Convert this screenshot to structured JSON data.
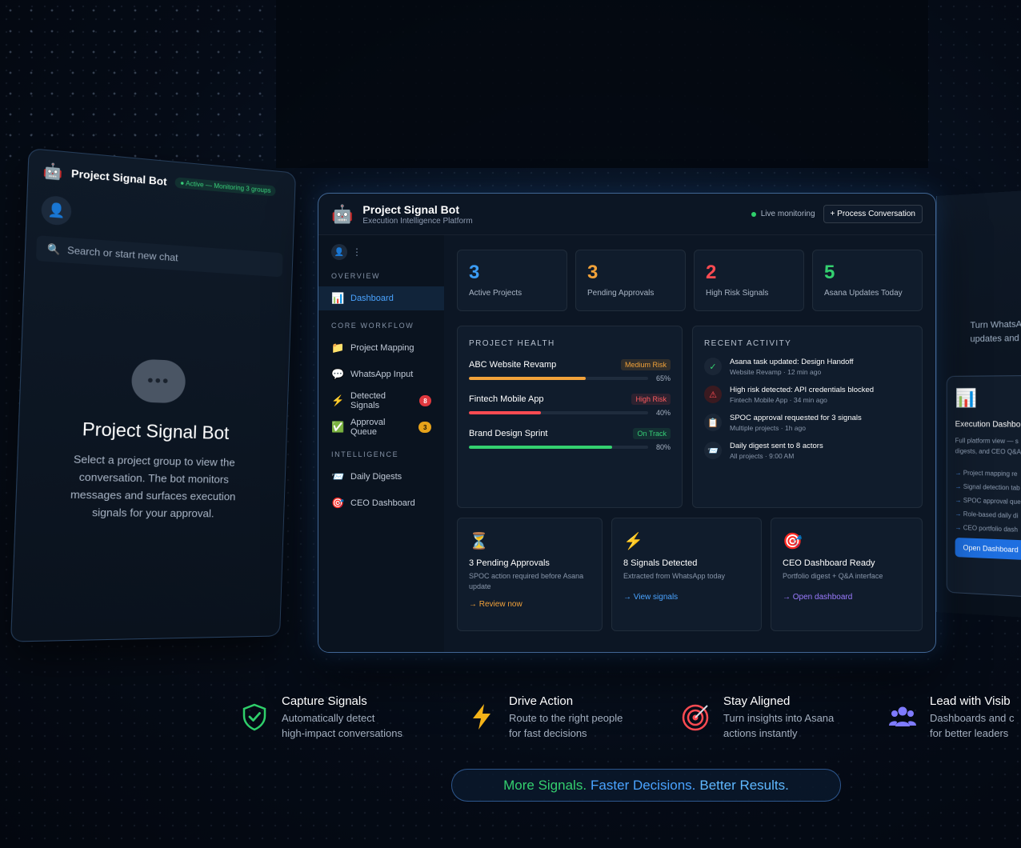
{
  "left_panel": {
    "title": "Project Signal Bot",
    "status": "● Active — Monitoring 3 groups",
    "search_placeholder": "Search or start new chat",
    "heading": "Project Signal Bot",
    "description": "Select a project group to view the conversation. The bot monitors messages and surfaces execution signals for your approval."
  },
  "right_panel": {
    "intro_line1": "Turn WhatsA",
    "intro_line2": "updates and",
    "card_title": "Execution Dashbo",
    "card_desc_line1": "Full platform view — s",
    "card_desc_line2": "digests, and CEO Q&A i",
    "items": [
      "Project mapping re",
      "Signal detection tab",
      "SPOC approval que",
      "Role-based daily di",
      "CEO portfolio dash"
    ],
    "button": "Open Dashboard"
  },
  "header": {
    "title": "Project Signal Bot",
    "subtitle": "Execution Intelligence Platform",
    "live": "Live monitoring",
    "process_button": "+ Process Conversation"
  },
  "sidebar": {
    "sections": {
      "overview": "OVERVIEW",
      "core": "CORE WORKFLOW",
      "intel": "INTELLIGENCE"
    },
    "items": [
      {
        "label": "Dashboard"
      },
      {
        "label": "Project Mapping"
      },
      {
        "label": "WhatsApp Input"
      },
      {
        "label": "Detected Signals",
        "badge": "8"
      },
      {
        "label": "Approval Queue",
        "badge": "3"
      },
      {
        "label": "Daily Digests"
      },
      {
        "label": "CEO Dashboard"
      }
    ]
  },
  "stats": [
    {
      "value": "3",
      "label": "Active Projects",
      "color": "#3b9cf5"
    },
    {
      "value": "3",
      "label": "Pending Approvals",
      "color": "#f2a23a"
    },
    {
      "value": "2",
      "label": "High Risk Signals",
      "color": "#ff4b52"
    },
    {
      "value": "5",
      "label": "Asana Updates Today",
      "color": "#34d06f"
    }
  ],
  "health": {
    "title": "PROJECT HEALTH",
    "projects": [
      {
        "name": "ABC Website Revamp",
        "status": "Medium Risk",
        "percent": "65%",
        "value": 0.65,
        "color": "#f2a23a"
      },
      {
        "name": "Fintech Mobile App",
        "status": "High Risk",
        "percent": "40%",
        "value": 0.4,
        "color": "#ff4b52"
      },
      {
        "name": "Brand Design Sprint",
        "status": "On Track",
        "percent": "80%",
        "value": 0.8,
        "color": "#34d06f"
      }
    ]
  },
  "activity": {
    "title": "RECENT ACTIVITY",
    "items": [
      {
        "icon": "✓",
        "text": "Asana task updated: Design Handoff",
        "meta": "Website Revamp · 12 min ago"
      },
      {
        "icon": "⚠",
        "text": "High risk detected: API credentials blocked",
        "meta": "Fintech Mobile App · 34 min ago"
      },
      {
        "icon": "📋",
        "text": "SPOC approval requested for 3 signals",
        "meta": "Multiple projects · 1h ago"
      },
      {
        "icon": "📨",
        "text": "Daily digest sent to 8 actors",
        "meta": "All projects · 9:00 AM"
      }
    ]
  },
  "quick_cards": [
    {
      "icon": "⏳",
      "title": "3 Pending Approvals",
      "desc": "SPOC action required before Asana update",
      "link": "→ Review now",
      "link_color": "#f2a23a"
    },
    {
      "icon": "⚡",
      "title": "8 Signals Detected",
      "desc": "Extracted from WhatsApp today",
      "link": "→ View signals",
      "link_color": "#4aa3ff"
    },
    {
      "icon": "🎯",
      "title": "CEO Dashboard Ready",
      "desc": "Portfolio digest + Q&A interface",
      "link": "→ Open dashboard",
      "link_color": "#9b7bff"
    }
  ],
  "features": [
    {
      "title": "Capture Signals",
      "line1": "Automatically detect",
      "line2": "high-impact conversations"
    },
    {
      "title": "Drive Action",
      "line1": "Route to the right people",
      "line2": "for fast decisions"
    },
    {
      "title": "Stay Aligned",
      "line1": "Turn insights into Asana",
      "line2": "actions instantly"
    },
    {
      "title": "Lead with Visib",
      "line1": "Dashboards and c",
      "line2": "for better leaders"
    }
  ],
  "tagline": {
    "part1": "More Signals.",
    "part2": "Faster Decisions.",
    "part3": "Better Results."
  }
}
